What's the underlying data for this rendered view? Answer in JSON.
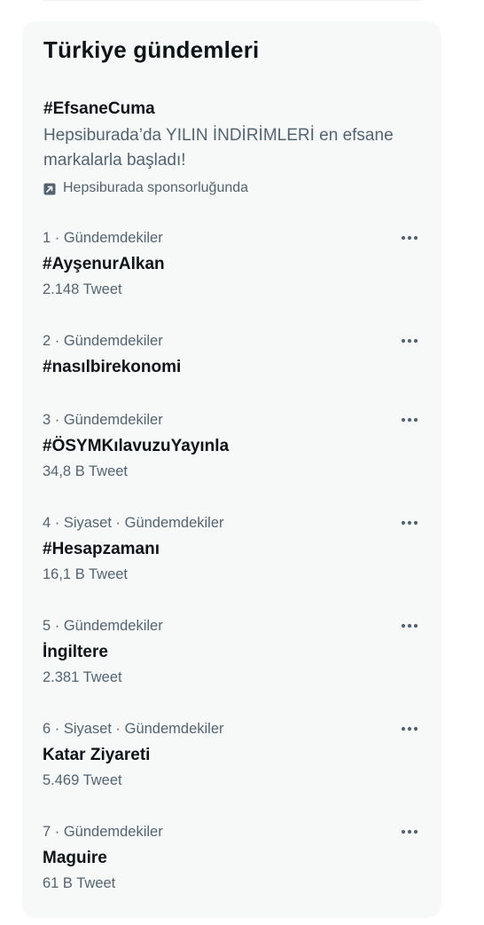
{
  "section": {
    "title": "Türkiye gündemleri"
  },
  "promoted": {
    "hashtag": "#EfsaneCuma",
    "description": "Hepsiburada’da YILIN İNDİRİMLERİ en efsane markalarla başladı!",
    "sponsor_text": "Hepsiburada sponsorluğunda",
    "sponsor_icon": "promoted-arrow-icon"
  },
  "trends": [
    {
      "meta": "1 · Gündemdekiler",
      "name": "#AyşenurAlkan",
      "count": "2.148 Tweet"
    },
    {
      "meta": "2 · Gündemdekiler",
      "name": "#nasılbirekonomi",
      "count": ""
    },
    {
      "meta": "3 · Gündemdekiler",
      "name": "#ÖSYMKılavuzuYayınla",
      "count": "34,8 B Tweet"
    },
    {
      "meta": "4 · Siyaset · Gündemdekiler",
      "name": "#Hesapzamanı",
      "count": "16,1 B Tweet"
    },
    {
      "meta": "5 · Gündemdekiler",
      "name": "İngiltere",
      "count": "2.381 Tweet"
    },
    {
      "meta": "6 · Siyaset · Gündemdekiler",
      "name": "Katar Ziyareti",
      "count": "5.469 Tweet"
    },
    {
      "meta": "7 · Gündemdekiler",
      "name": "Maguire",
      "count": "61 B Tweet"
    }
  ],
  "icons": {
    "more": "more-horizontal-icon"
  },
  "colors": {
    "panel_bg": "#f7f9f9",
    "primary_text": "#0f1419",
    "secondary_text": "#536471"
  }
}
